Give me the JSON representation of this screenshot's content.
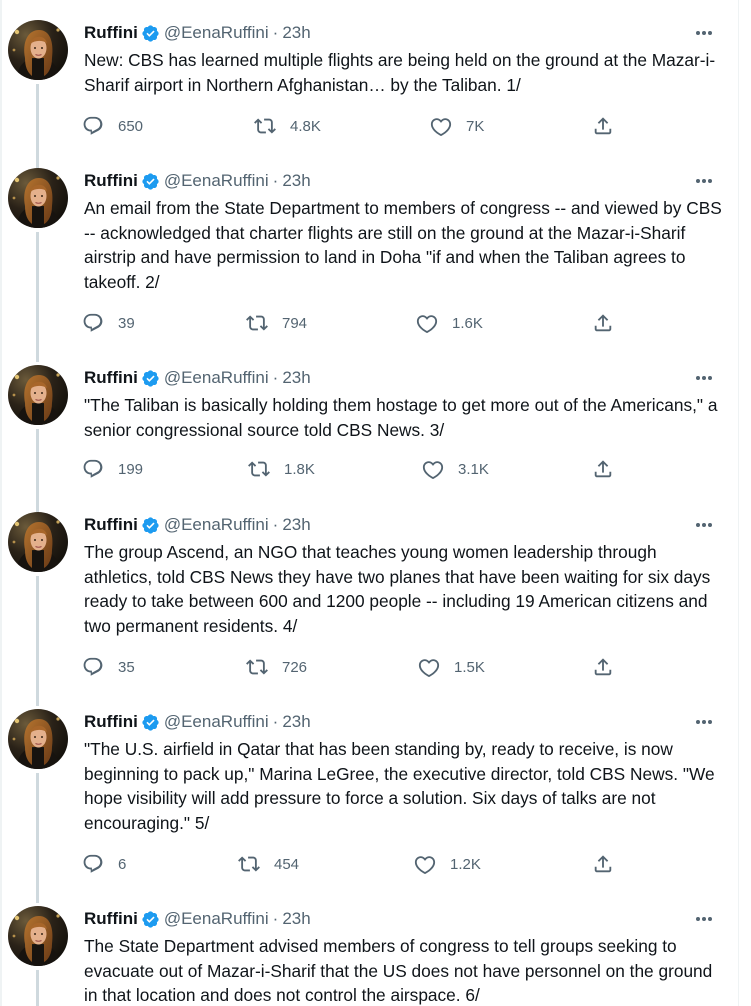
{
  "author": {
    "name": "Ruffini",
    "handle": "@EenaRuffini",
    "separator": "·",
    "avatar_icon": "profile-photo"
  },
  "colors": {
    "verified": "#1d9bf0",
    "muted": "#536471",
    "text": "#0f1419",
    "thread_line": "#cfd9de"
  },
  "tweets": [
    {
      "time": "23h",
      "text": "New: CBS has learned multiple flights are being held on the ground at the Mazar-i-Sharif airport in Northern Afghanistan… by the Taliban. 1/",
      "replies": "650",
      "retweets": "4.8K",
      "likes": "7K"
    },
    {
      "time": "23h",
      "text": "An email from the State Department to members of congress --  and viewed by CBS  -- acknowledged that charter flights are still on the ground at the Mazar-i-Sharif airstrip and have permission to land in Doha \"if and when the Taliban agrees to takeoff. 2/",
      "replies": "39",
      "retweets": "794",
      "likes": "1.6K"
    },
    {
      "time": "23h",
      "text": "\"The Taliban is basically holding them hostage to get more out of the Americans,\" a senior congressional source told CBS News. 3/",
      "replies": "199",
      "retweets": "1.8K",
      "likes": "3.1K"
    },
    {
      "time": "23h",
      "text": "The group Ascend, an NGO that teaches young women leadership through athletics, told CBS News they have two planes that have been waiting for six days ready to take between 600 and 1200 people -- including 19 American citizens and two permanent residents. 4/",
      "replies": "35",
      "retweets": "726",
      "likes": "1.5K"
    },
    {
      "time": "23h",
      "text": "\"The U.S. airfield in Qatar that has been standing by, ready to receive, is now beginning to pack up,\" Marina LeGree, the executive director, told CBS News. \"We hope visibility will add pressure to force a solution. Six days of talks are not encouraging.\" 5/",
      "replies": "6",
      "retweets": "454",
      "likes": "1.2K"
    },
    {
      "time": "23h",
      "text": "The State Department advised members of congress to tell groups seeking to evacuate out of Mazar-i-Sharif that the US does not have personnel on the ground in that location and does not control the airspace. 6/",
      "replies": "",
      "retweets": "",
      "likes": ""
    }
  ]
}
